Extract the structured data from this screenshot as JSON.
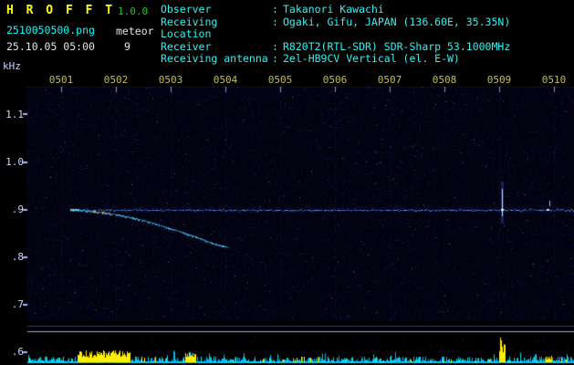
{
  "header": {
    "app_title": "H R O F F T",
    "version": "1.0.0",
    "filename": "2510050500.png",
    "mode": "meteor",
    "datetime": "25.10.05 05:00",
    "count": "9",
    "colon": ":",
    "info": [
      {
        "label": "Observer",
        "value": "Takanori Kawachi"
      },
      {
        "label": "Receiving Location",
        "value": "Ogaki, Gifu, JAPAN (136.60E, 35.35N)"
      },
      {
        "label": "Receiver",
        "value": "R820T2(RTL-SDR) SDR-Sharp 53.1000MHz"
      },
      {
        "label": "Receiving antenna",
        "value": "2el-HB9CV Vertical (el. E-W)"
      }
    ]
  },
  "colors": {
    "title_yellow": "#ffff00",
    "version_green": "#1acc1a",
    "cyan_text": "#2ef2f2",
    "time_tick": "#bdbd5c",
    "freq_label": "#ccd4ff",
    "carrier_blue": "#4673ff",
    "trace_cyan": "#46bee6",
    "hot_red": "#ff4422",
    "hot_orange": "#ffaa00",
    "spike_bright": "#bdd2ff",
    "strip_cyan": "#00d2ff",
    "strip_yellow": "#ffee00"
  },
  "chart_data": {
    "type": "heatmap",
    "title": "HROFFT radio meteor observation spectrogram 05:00-05:10",
    "ylabel": "kHz",
    "x_ticks": [
      "0501",
      "0502",
      "0503",
      "0504",
      "0505",
      "0506",
      "0507",
      "0508",
      "0509",
      "0510"
    ],
    "y_ticks": [
      "1.1",
      "1.0",
      ".9",
      ".8",
      ".7",
      ".6"
    ],
    "y_tick_khz": [
      1.1,
      1.0,
      0.9,
      0.8,
      0.7,
      0.6
    ],
    "x_range_min": [
      0.38,
      10.37
    ],
    "y_range_khz": [
      0.655,
      1.15
    ],
    "legend_position": "none",
    "grid": "vertical-minute-dotted",
    "carrier": {
      "khz": 0.9,
      "t_start_min": 1.18,
      "t_end_min": 10.37
    },
    "doppler_trace": {
      "points_min_khz": [
        [
          1.18,
          0.9
        ],
        [
          1.45,
          0.898
        ],
        [
          1.75,
          0.894
        ],
        [
          2.05,
          0.889
        ],
        [
          2.35,
          0.882
        ],
        [
          2.65,
          0.873
        ],
        [
          2.95,
          0.862
        ],
        [
          3.25,
          0.851
        ],
        [
          3.55,
          0.839
        ],
        [
          3.8,
          0.828
        ],
        [
          4.05,
          0.821
        ]
      ]
    },
    "hot_spots_min_khz": [
      [
        1.6,
        0.8965
      ],
      [
        1.68,
        0.896
      ],
      [
        1.76,
        0.895
      ],
      [
        1.88,
        0.8935
      ]
    ],
    "meteor_spike": {
      "t_min": 9.05,
      "khz_lo": 0.885,
      "khz_hi": 0.944
    },
    "minor_spike": {
      "t_min": 9.93,
      "khz_lo": 0.905,
      "khz_hi": 0.918
    },
    "strip_yellow_regions_min": [
      [
        1.3,
        2.25,
        13
      ],
      [
        3.27,
        3.45,
        11
      ],
      [
        9.0,
        9.1,
        27
      ],
      [
        9.86,
        9.95,
        7
      ]
    ]
  }
}
